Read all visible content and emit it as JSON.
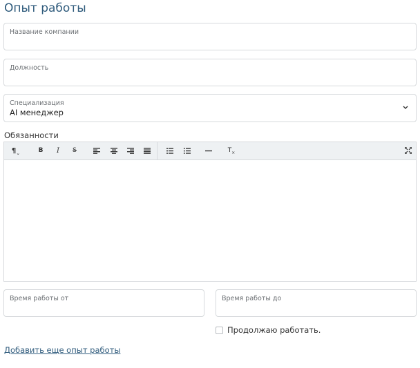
{
  "title": "Опыт работы",
  "fields": {
    "company": {
      "label": "Название компании",
      "value": ""
    },
    "position": {
      "label": "Должность",
      "value": ""
    },
    "specialization": {
      "label": "Специализация",
      "value": "AI менеджер"
    }
  },
  "duties": {
    "label": "Обязанности",
    "toolbar": {
      "paragraph": "¶",
      "bold": "B",
      "italic": "I",
      "strike": "S",
      "clear_format": "T"
    },
    "content": ""
  },
  "work_time": {
    "from_label": "Время работы от",
    "to_label": "Время работы до"
  },
  "still_working": {
    "label": "Продолжаю работать.",
    "checked": false
  },
  "add_link": "Добавить еще опыт работы",
  "colors": {
    "accent": "#2f5b7c",
    "border": "#d6d9dc",
    "toolbar_bg": "#eef1f3"
  }
}
